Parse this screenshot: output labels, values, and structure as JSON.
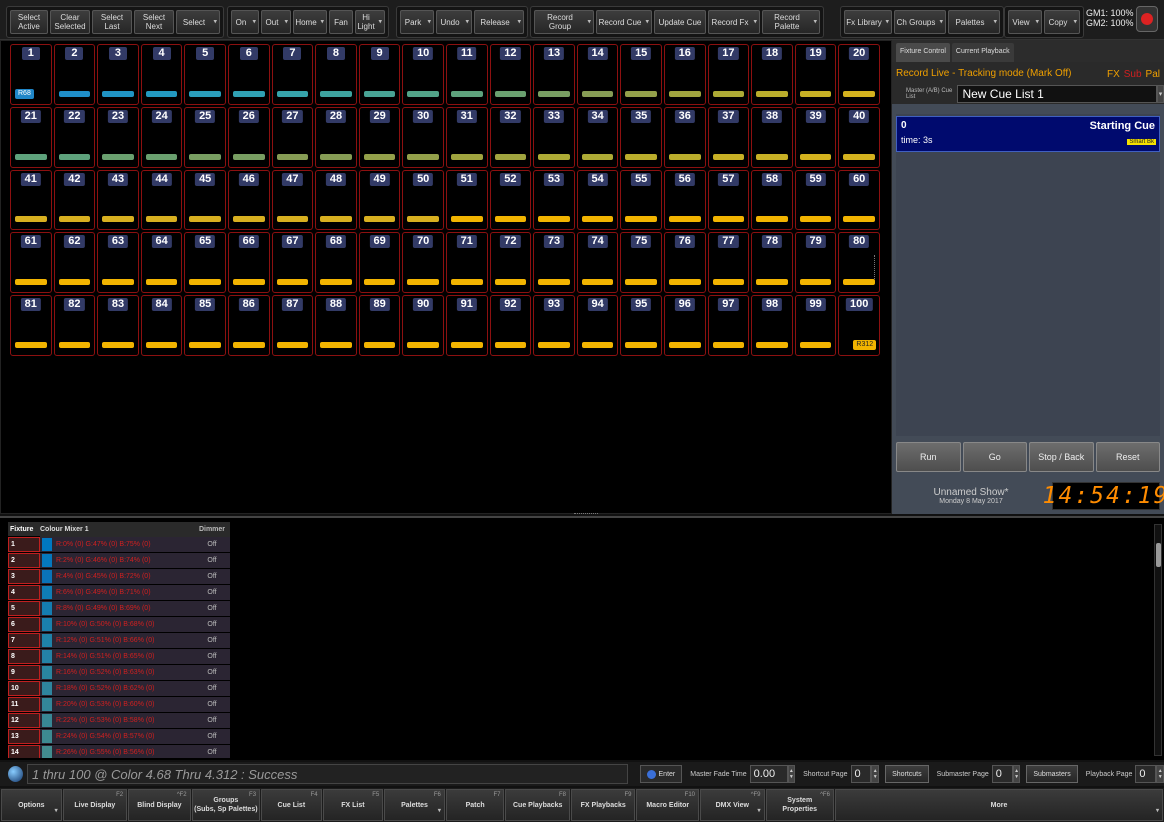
{
  "toolbar": {
    "group1": [
      "Select\nActive",
      "Clear\nSelected",
      "Select\nLast",
      "Select\nNext",
      "Select"
    ],
    "group2": [
      "On",
      "Out",
      "Home",
      "Fan",
      "Hi\nLight"
    ],
    "group3": [
      "Park",
      "Undo",
      "Release"
    ],
    "group4": [
      "Record Group",
      "Record Cue",
      "Update Cue",
      "Record Fx",
      "Record Palette"
    ],
    "group5": [
      "Fx Library",
      "Ch Groups",
      "Palettes"
    ],
    "group6": [
      "View",
      "Copy"
    ],
    "gm1": "GM1: 100%",
    "gm2": "GM2: 100%"
  },
  "fixtures": {
    "labels": [
      "1",
      "2",
      "3",
      "4",
      "5",
      "6",
      "7",
      "8",
      "9",
      "10",
      "11",
      "12",
      "13",
      "14",
      "15",
      "16",
      "17",
      "18",
      "19",
      "20",
      "21",
      "22",
      "23",
      "24",
      "25",
      "26",
      "27",
      "28",
      "29",
      "30",
      "31",
      "32",
      "33",
      "34",
      "35",
      "36",
      "37",
      "38",
      "39",
      "40",
      "41",
      "42",
      "43",
      "44",
      "45",
      "46",
      "47",
      "48",
      "49",
      "50",
      "51",
      "52",
      "53",
      "54",
      "55",
      "56",
      "57",
      "58",
      "59",
      "60",
      "61",
      "62",
      "63",
      "64",
      "65",
      "66",
      "67",
      "68",
      "69",
      "70",
      "71",
      "72",
      "73",
      "74",
      "75",
      "76",
      "77",
      "78",
      "79",
      "80",
      "81",
      "82",
      "83",
      "84",
      "85",
      "86",
      "87",
      "88",
      "89",
      "90",
      "91",
      "92",
      "93",
      "94",
      "95",
      "96",
      "97",
      "98",
      "99",
      "100"
    ],
    "first_badge": "R68",
    "last_badge": "R312"
  },
  "right_panel": {
    "tabs": [
      "Fixture Control",
      "Current Playback"
    ],
    "record_mode": "Record Live - Tracking mode (Mark Off)",
    "flags": [
      {
        "text": "FX",
        "color": "#f0a000"
      },
      {
        "text": "Sub",
        "color": "#d02020"
      },
      {
        "text": "Pal",
        "color": "#f0a000"
      }
    ],
    "cue_list_label": "Master (A/B) Cue List",
    "cue_list_value": "New Cue List 1",
    "cue": {
      "number": "0",
      "name": "Starting Cue",
      "time": "time: 3s",
      "badge": "Smart Bk"
    },
    "buttons": [
      "Run",
      "Go",
      "Stop / Back",
      "Reset"
    ],
    "show_name": "Unnamed Show*",
    "date": "Monday 8 May  2017",
    "clock": "14:54:19"
  },
  "fixture_table": {
    "headers": [
      "Fixture",
      "Colour Mixer 1",
      "Dimmer"
    ],
    "rows": [
      {
        "fixture": "1",
        "colour": "R:0% (0) G:47% (0) B:75% (0)",
        "dimmer": "Off",
        "swatch": "#0078c0"
      },
      {
        "fixture": "2",
        "colour": "R:2% (0) G:46% (0) B:74% (0)",
        "dimmer": "Off",
        "swatch": "#0578bd"
      },
      {
        "fixture": "3",
        "colour": "R:4% (0) G:45% (0) B:72% (0)",
        "dimmer": "Off",
        "swatch": "#0a73b8"
      },
      {
        "fixture": "4",
        "colour": "R:6% (0) G:49% (0) B:71% (0)",
        "dimmer": "Off",
        "swatch": "#0f7db5"
      },
      {
        "fixture": "5",
        "colour": "R:8% (0) G:49% (0) B:69% (0)",
        "dimmer": "Off",
        "swatch": "#147db0"
      },
      {
        "fixture": "6",
        "colour": "R:10% (0) G:50% (0) B:68% (0)",
        "dimmer": "Off",
        "swatch": "#1a80ad"
      },
      {
        "fixture": "7",
        "colour": "R:12% (0) G:51% (0) B:66% (0)",
        "dimmer": "Off",
        "swatch": "#1f82a8"
      },
      {
        "fixture": "8",
        "colour": "R:14% (0) G:51% (0) B:65% (0)",
        "dimmer": "Off",
        "swatch": "#2482a6"
      },
      {
        "fixture": "9",
        "colour": "R:16% (0) G:52% (0) B:63% (0)",
        "dimmer": "Off",
        "swatch": "#2985a0"
      },
      {
        "fixture": "10",
        "colour": "R:18% (0) G:52% (0) B:62% (0)",
        "dimmer": "Off",
        "swatch": "#2e859e"
      },
      {
        "fixture": "11",
        "colour": "R:20% (0) G:53% (0) B:60% (0)",
        "dimmer": "Off",
        "swatch": "#338799"
      },
      {
        "fixture": "12",
        "colour": "R:22% (0) G:53% (0) B:58% (0)",
        "dimmer": "Off",
        "swatch": "#388794"
      },
      {
        "fixture": "13",
        "colour": "R:24% (0) G:54% (0) B:57% (0)",
        "dimmer": "Off",
        "swatch": "#3d8a91"
      },
      {
        "fixture": "14",
        "colour": "R:26% (0) G:55% (0) B:56% (0)",
        "dimmer": "Off",
        "swatch": "#428c8f"
      }
    ]
  },
  "command": {
    "text": "1 thru 100 @ Color 4.68 Thru 4.312 : Success",
    "enter": "Enter",
    "master_fade_label": "Master Fade Time",
    "master_fade_value": "0.00",
    "shortcut_page_label": "Shortcut Page",
    "shortcut_page_value": "0",
    "shortcuts_btn": "Shortcuts",
    "submaster_page_label": "Submaster Page",
    "submaster_page_value": "0",
    "submasters_btn": "Submasters",
    "playback_page_label": "Playback Page",
    "playback_page_value": "0"
  },
  "fkeys": [
    {
      "label": "Options",
      "key": ""
    },
    {
      "label": "Live Display",
      "key": "F2"
    },
    {
      "label": "Blind Display",
      "key": "^F2"
    },
    {
      "label": "Groups\n(Subs, Sp Palettes)",
      "key": "F3"
    },
    {
      "label": "Cue List",
      "key": "F4"
    },
    {
      "label": "FX List",
      "key": "F5"
    },
    {
      "label": "Palettes",
      "key": "F6"
    },
    {
      "label": "Patch",
      "key": "F7"
    },
    {
      "label": "Cue Playbacks",
      "key": "F8"
    },
    {
      "label": "FX Playbacks",
      "key": "F9"
    },
    {
      "label": "Macro Editor",
      "key": "F10"
    },
    {
      "label": "DMX View",
      "key": "^F9"
    },
    {
      "label": "System\nProperties",
      "key": "^F6"
    },
    {
      "label": "More",
      "key": ""
    }
  ]
}
